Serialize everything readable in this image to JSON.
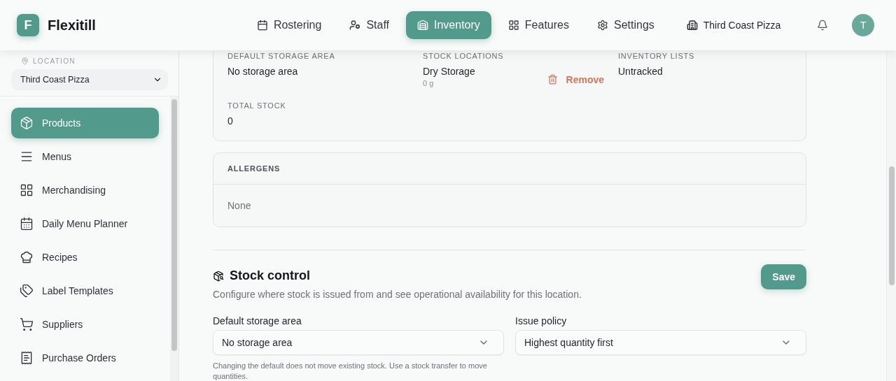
{
  "brand": {
    "initial": "F",
    "name": "Flexitill"
  },
  "nav": [
    {
      "label": "Rostering",
      "selected": false
    },
    {
      "label": "Staff",
      "selected": false
    },
    {
      "label": "Inventory",
      "selected": true
    },
    {
      "label": "Features",
      "selected": false
    },
    {
      "label": "Settings",
      "selected": false
    }
  ],
  "venue": "Third Coast Pizza",
  "avatar": "T",
  "location": {
    "label": "LOCATION",
    "value": "Third Coast Pizza"
  },
  "sidebar": {
    "items": [
      {
        "label": "Products",
        "selected": true
      },
      {
        "label": "Menus",
        "selected": false
      },
      {
        "label": "Merchandising",
        "selected": false
      },
      {
        "label": "Daily Menu Planner",
        "selected": false
      },
      {
        "label": "Recipes",
        "selected": false
      },
      {
        "label": "Label Templates",
        "selected": false
      },
      {
        "label": "Suppliers",
        "selected": false
      },
      {
        "label": "Purchase Orders",
        "selected": false
      }
    ]
  },
  "stock_card": {
    "default_storage_label": "DEFAULT STORAGE AREA",
    "default_storage_value": "No storage area",
    "locations_label": "STOCK LOCATIONS",
    "location_name": "Dry Storage",
    "location_qty": "0 g",
    "remove": "Remove",
    "lists_label": "INVENTORY LISTS",
    "lists_value": "Untracked",
    "total_label": "TOTAL STOCK",
    "total_value": "0"
  },
  "allergens": {
    "title": "ALLERGENS",
    "value": "None"
  },
  "stock_control": {
    "title": "Stock control",
    "description": "Configure where stock is issued from and see operational availability for this location.",
    "save": "Save",
    "fields": [
      {
        "label": "Default storage area",
        "value": "No storage area",
        "hint": "Changing the default does not move existing stock. Use a stock transfer to move quantities."
      },
      {
        "label": "Issue policy",
        "value": "Highest quantity first"
      }
    ]
  }
}
